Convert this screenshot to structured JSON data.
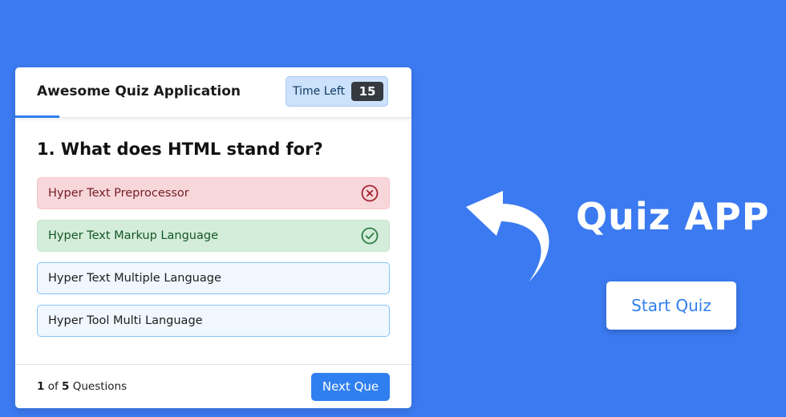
{
  "quiz": {
    "app_title": "Awesome Quiz Application",
    "timer": {
      "label": "Time Left",
      "seconds": "15"
    },
    "question": {
      "number": "1.",
      "text": "What does HTML stand for?",
      "full": "1. What does HTML stand for?"
    },
    "options": [
      {
        "label": "Hyper Text Preprocessor",
        "state": "incorrect",
        "icon": "cross-icon"
      },
      {
        "label": "Hyper Text Markup Language",
        "state": "correct",
        "icon": "tick-icon"
      },
      {
        "label": "Hyper Text Multiple Language",
        "state": "default"
      },
      {
        "label": "Hyper Tool Multi Language",
        "state": "default"
      }
    ],
    "footer": {
      "current": "1",
      "of": "of",
      "total": "5",
      "suffix": "Questions",
      "next_label": "Next Que"
    }
  },
  "brand": {
    "title": "Quiz APP",
    "start_label": "Start Quiz"
  },
  "colors": {
    "background": "#3b7af0",
    "accent": "#2f7ff0",
    "correct": "#d4edda",
    "incorrect": "#f8d7da",
    "option_default": "#f0f7ff"
  }
}
